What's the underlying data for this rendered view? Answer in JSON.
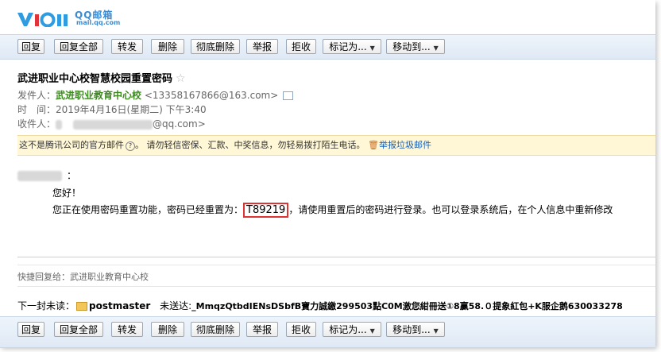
{
  "app": {
    "logo_cn": "QQ邮箱",
    "logo_en": "mail.qq.com"
  },
  "toolbar": {
    "reply": "回复",
    "reply_all": "回复全部",
    "forward": "转发",
    "delete": "删除",
    "delete_forever": "彻底删除",
    "report": "举报",
    "reject": "拒收",
    "mark_as": "标记为...",
    "move_to": "移动到..."
  },
  "mail": {
    "subject": "武进职业中心校智慧校园重置密码",
    "star": "☆",
    "sender_label": "发件人：",
    "sender_name": "武进职业教育中心校",
    "sender_email": "<13358167866@163.com>",
    "time_label": "时　间：",
    "time_value": "2019年4月16日(星期二) 下午3:40",
    "recipient_label": "收件人：",
    "recipient_suffix": "@qq.com>"
  },
  "notice": {
    "text1": "这不是腾讯公司的官方邮件",
    "text2": "。 请勿轻信密保、汇款、中奖信息，勿轻易拨打陌生电话。",
    "report_link": "举报垃圾邮件"
  },
  "body": {
    "colon": "：",
    "greeting": "您好！",
    "line_prefix": "您正在使用密码重置功能，密码已经重置为：",
    "password": "T89219",
    "line_suffix": "，请使用重置后的密码进行登录。也可以登录系统后，在个人信息中重新修改"
  },
  "quick_reply": "快捷回复给：武进职业教育中心校",
  "next_unread": {
    "label": "下一封未读：",
    "sender": "postmaster",
    "unsent_label": "未送达:",
    "unsent_text": "_MmqzQtbdIENsDSbfB寶力誠繳299503點C0M激您紺冊送①8赢58.０提象紅包+K服企鹅630033278"
  },
  "colors": {
    "accent": "#3b8bd3",
    "sender_green": "#3c8a1e",
    "highlight_red": "#e03434",
    "notice_bg": "#fff7d6"
  }
}
